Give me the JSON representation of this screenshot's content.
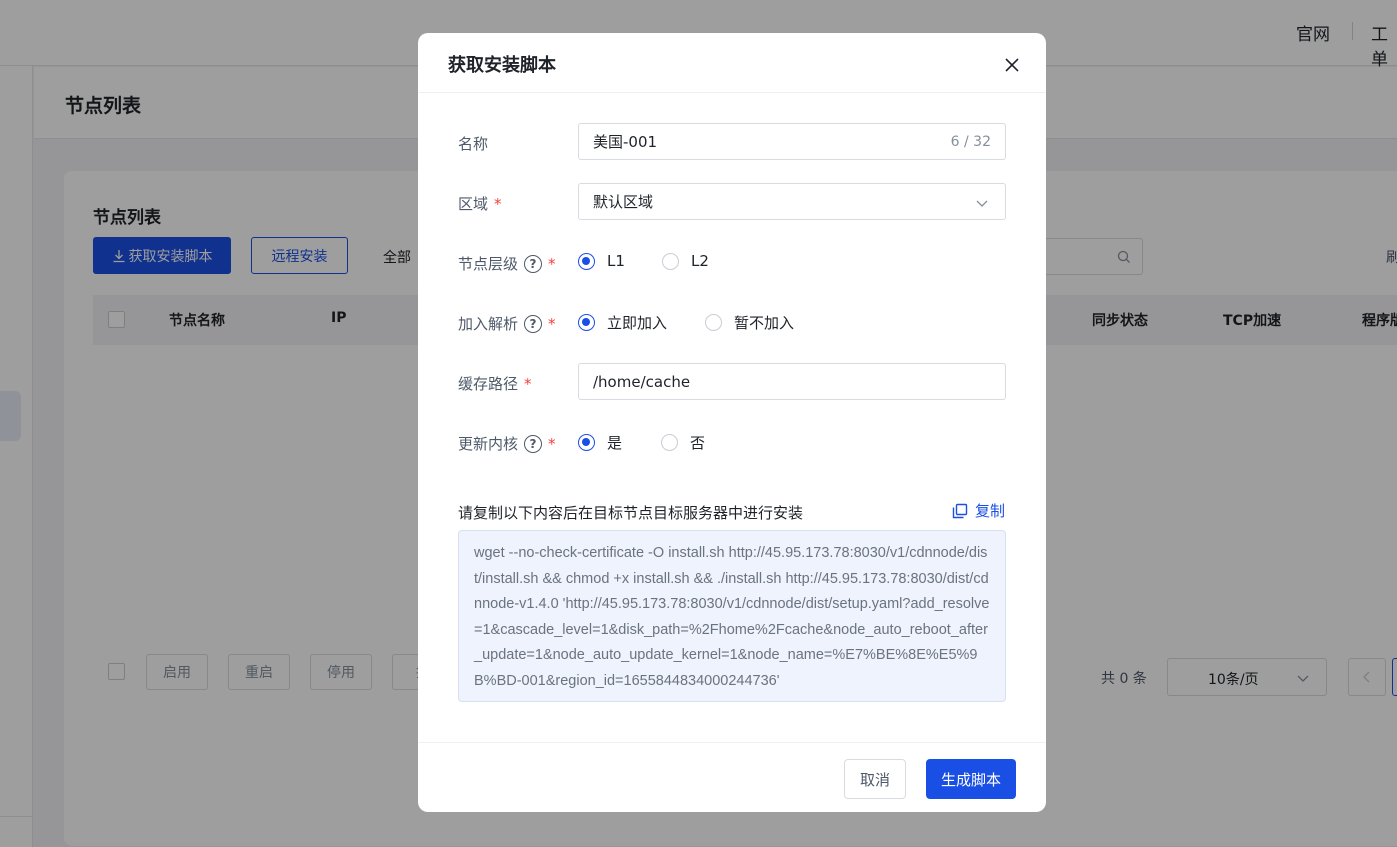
{
  "topbar": {
    "links": [
      "官网",
      "工单"
    ]
  },
  "page": {
    "header_title": "节点列表",
    "card_title": "节点列表",
    "toolbar": {
      "get_script_label": "获取安装脚本",
      "remote_install_label": "远程安装",
      "filter_all_label": "全部"
    },
    "table": {
      "columns": [
        "节点名称",
        "IP",
        "同步状态",
        "TCP加速",
        "程序版本"
      ]
    },
    "bulk_actions": [
      "启用",
      "重启",
      "停用",
      "批"
    ],
    "pagination": {
      "total": "共 0 条",
      "page_size": "10条/页"
    }
  },
  "modal": {
    "title": "获取安装脚本",
    "fields": {
      "name": {
        "label": "名称",
        "value": "美国-001",
        "counter": "6 / 32"
      },
      "region": {
        "label": "区域",
        "value": "默认区域"
      },
      "node_level": {
        "label": "节点层级",
        "options": [
          "L1",
          "L2"
        ],
        "selected": "L1"
      },
      "join_resolve": {
        "label": "加入解析",
        "options": [
          "立即加入",
          "暂不加入"
        ],
        "selected": "立即加入"
      },
      "cache_path": {
        "label": "缓存路径",
        "value": "/home/cache"
      },
      "update_kernel": {
        "label": "更新内核",
        "options": [
          "是",
          "否"
        ],
        "selected": "是"
      }
    },
    "note": "请复制以下内容后在目标节点目标服务器中进行安装",
    "copy_label": "复制",
    "script": "wget --no-check-certificate -O install.sh http://45.95.173.78:8030/v1/cdnnode/dist/install.sh && chmod +x install.sh && ./install.sh http://45.95.173.78:8030/dist/cdnnode-v1.4.0 'http://45.95.173.78:8030/v1/cdnnode/dist/setup.yaml?add_resolve=1&cascade_level=1&disk_path=%2Fhome%2Fcache&node_auto_reboot_after_update=1&node_auto_update_kernel=1&node_name=%E7%BE%8E%E5%9B%BD-001&region_id=1655844834000244736'",
    "cancel_label": "取消",
    "submit_label": "生成脚本"
  },
  "colors": {
    "primary": "#1a4fe6",
    "required": "#f53f3f",
    "script_bg": "#eef3fd"
  }
}
